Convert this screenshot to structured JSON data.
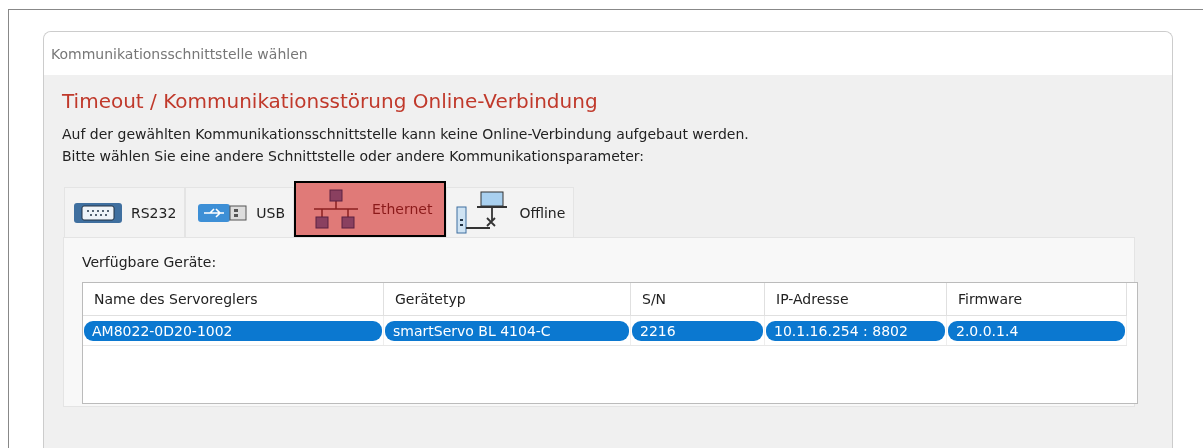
{
  "window": {
    "title": "Kommunikationsschnittstelle wählen"
  },
  "heading": "Timeout / Kommunikationsstörung Online-Verbindung",
  "message": [
    "Auf der gewählten Kommunikationsschnittstelle kann keine Online-Verbindung aufgebaut werden.",
    "Bitte wählen Sie eine andere Schnittstelle oder andere Kommunikationsparameter:"
  ],
  "tabs": [
    {
      "kind": "serial",
      "label": "RS232",
      "selected": false
    },
    {
      "kind": "usb",
      "label": "USB",
      "selected": false
    },
    {
      "kind": "network",
      "label": "Ethernet",
      "selected": true
    },
    {
      "kind": "offline",
      "label": "Offline",
      "selected": false
    }
  ],
  "devices_label": "Verfügbare Geräte:",
  "table": {
    "columns": [
      "Name des Servoreglers",
      "Gerätetyp",
      "S/N",
      "IP-Adresse",
      "Firmware"
    ],
    "rows": [
      {
        "cells": [
          "AM8022-0D20-1002",
          "smartServo BL 4104-C",
          "2216",
          "10.1.16.254 : 8802",
          "2.0.0.1.4"
        ],
        "selected": true
      }
    ]
  }
}
